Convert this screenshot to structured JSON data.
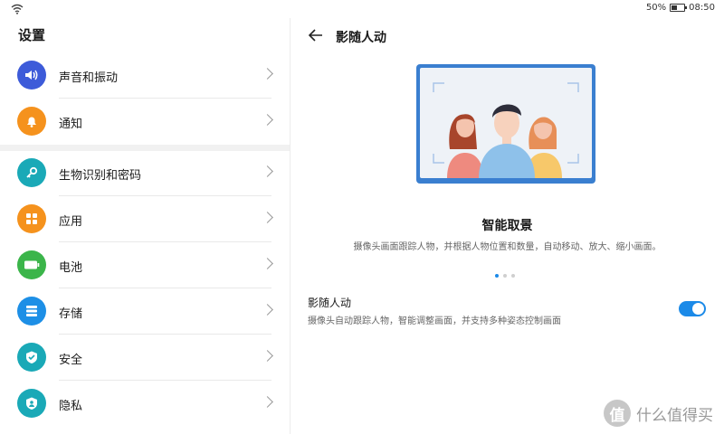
{
  "status_bar": {
    "battery": "50%",
    "time": "08:50"
  },
  "left": {
    "title": "设置",
    "items": [
      {
        "label": "声音和振动",
        "icon": "sound-icon",
        "color": "#3d5bd9"
      },
      {
        "label": "通知",
        "icon": "bell-icon",
        "color": "#f5921d"
      },
      {
        "label": "生物识别和密码",
        "icon": "key-icon",
        "color": "#1aa9b7"
      },
      {
        "label": "应用",
        "icon": "apps-icon",
        "color": "#f5921d"
      },
      {
        "label": "电池",
        "icon": "battery-icon",
        "color": "#3bb54a"
      },
      {
        "label": "存储",
        "icon": "storage-icon",
        "color": "#1d8fe6"
      },
      {
        "label": "安全",
        "icon": "shield-check-icon",
        "color": "#1aa9b7"
      },
      {
        "label": "隐私",
        "icon": "privacy-icon",
        "color": "#1aa9b7"
      }
    ]
  },
  "right": {
    "title": "影随人动",
    "feature_title": "智能取景",
    "feature_desc": "摄像头画面跟踪人物，并根据人物位置和数量，自动移动、放大、缩小画面。",
    "setting_title": "影随人动",
    "setting_desc": "摄像头自动跟踪人物，智能调整画面，并支持多种姿态控制画面",
    "toggle_on": true,
    "accent": "#1b8ae8"
  },
  "watermark": {
    "logo": "值",
    "text": "什么值得买"
  }
}
